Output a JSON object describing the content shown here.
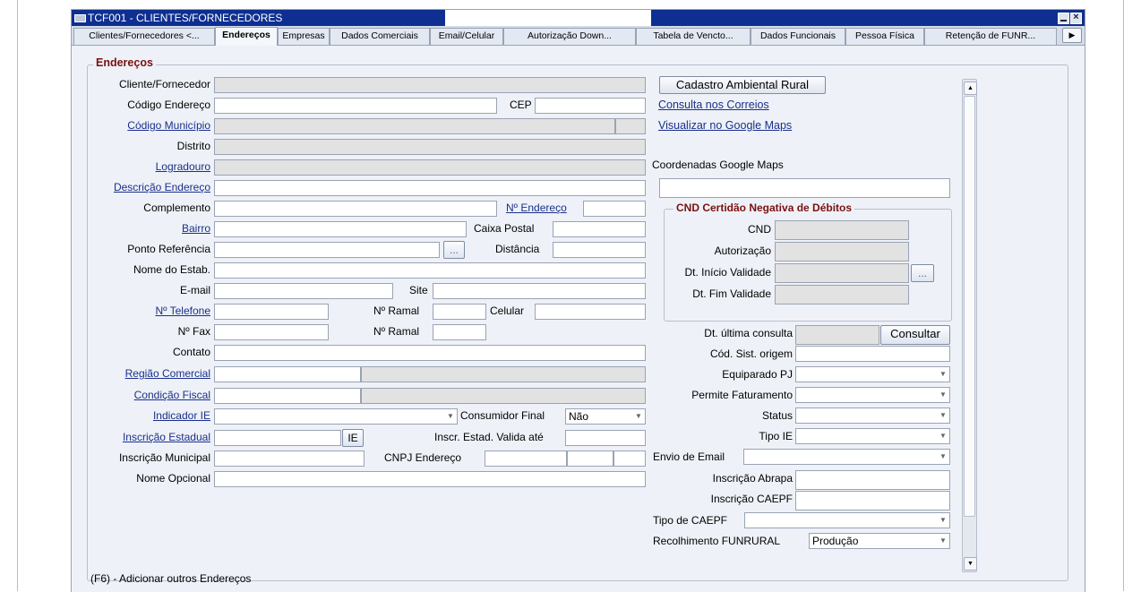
{
  "window": {
    "title": "TCF001 - CLIENTES/FORNECEDORES"
  },
  "tabs": [
    {
      "label": "Clientes/Fornecedores <..."
    },
    {
      "label": "Endereços"
    },
    {
      "label": "Empresas"
    },
    {
      "label": "Dados Comerciais"
    },
    {
      "label": "Email/Celular"
    },
    {
      "label": "Autorização Down..."
    },
    {
      "label": "Tabela de Vencto..."
    },
    {
      "label": "Dados Funcionais"
    },
    {
      "label": "Pessoa Física"
    },
    {
      "label": "Retenção de FUNR..."
    }
  ],
  "tab_scroll_icon": "arrow-right",
  "section": {
    "title": "Endereços",
    "footer": "(F6) - Adicionar outros Endereços"
  },
  "labels": {
    "cliente_fornecedor": "Cliente/Fornecedor",
    "codigo_endereco": "Código Endereço",
    "codigo_municipio": "Código Município",
    "distrito": "Distrito",
    "logradouro": "Logradouro",
    "descricao_endereco": "Descrição Endereço",
    "complemento": "Complemento",
    "bairro": "Bairro",
    "ponto_referencia": "Ponto Referência",
    "nome_estab": "Nome do Estab.",
    "email": "E-mail",
    "telefone": "Nº Telefone",
    "fax": "Nº Fax",
    "contato": "Contato",
    "regiao_comercial": "Região Comercial",
    "condicao_fiscal": "Condição Fiscal",
    "indicador_ie": "Indicador IE",
    "inscricao_estadual": "Inscrição Estadual",
    "inscricao_municipal": "Inscrição Municipal",
    "nome_opcional": "Nome Opcional",
    "cep": "CEP",
    "numero_endereco": "Nº Endereço",
    "caixa_postal": "Caixa Postal",
    "distancia": "Distância",
    "site": "Site",
    "ramal": "Nº Ramal",
    "ramal2": "Nº Ramal",
    "celular": "Celular",
    "consumidor_final": "Consumidor Final",
    "inscr_valida_ate": "Inscr. Estad. Valida até",
    "cnpj_endereco": "CNPJ Endereço",
    "coordenadas": "Coordenadas Google Maps",
    "dt_ultima_consulta": "Dt. última consulta",
    "cod_sist_origem": "Cód. Sist. origem",
    "equiparado_pj": "Equiparado PJ",
    "permite_faturamento": "Permite Faturamento",
    "status": "Status",
    "tipo_ie": "Tipo IE",
    "envio_email": "Envio de Email",
    "inscricao_abrapa": "Inscrição Abrapa",
    "inscricao_caepf": "Inscrição CAEPF",
    "tipo_caepf": "Tipo de CAEPF",
    "recolhimento_funrural": "Recolhimento FUNRURAL"
  },
  "values": {
    "consumidor_final": "Não",
    "recolhimento_funrural": "Produção"
  },
  "buttons": {
    "cadastro_ambiental": "Cadastro Ambiental Rural",
    "consultar": "Consultar",
    "ie": "IE",
    "ellipsis": "...",
    "ellipsis2": "..."
  },
  "links": {
    "correios": "Consulta nos Correios",
    "google_maps": "Visualizar no Google Maps"
  },
  "cnd": {
    "title": "CND Certidão Negativa de Débitos",
    "cnd": "CND",
    "autorizacao": "Autorização",
    "dt_inicio": "Dt. Início Validade",
    "dt_fim": "Dt. Fim Validade"
  },
  "icons": {
    "minimize": "minimize-icon",
    "close": "close-icon",
    "dropdown": "chevron-down-icon",
    "scroll_up": "arrow-up-icon",
    "scroll_down": "arrow-down-icon"
  },
  "colors": {
    "titlebar": "#0e2f91",
    "section_title": "#7a1010",
    "link": "#1a2f8a",
    "background": "#eef2f8"
  }
}
